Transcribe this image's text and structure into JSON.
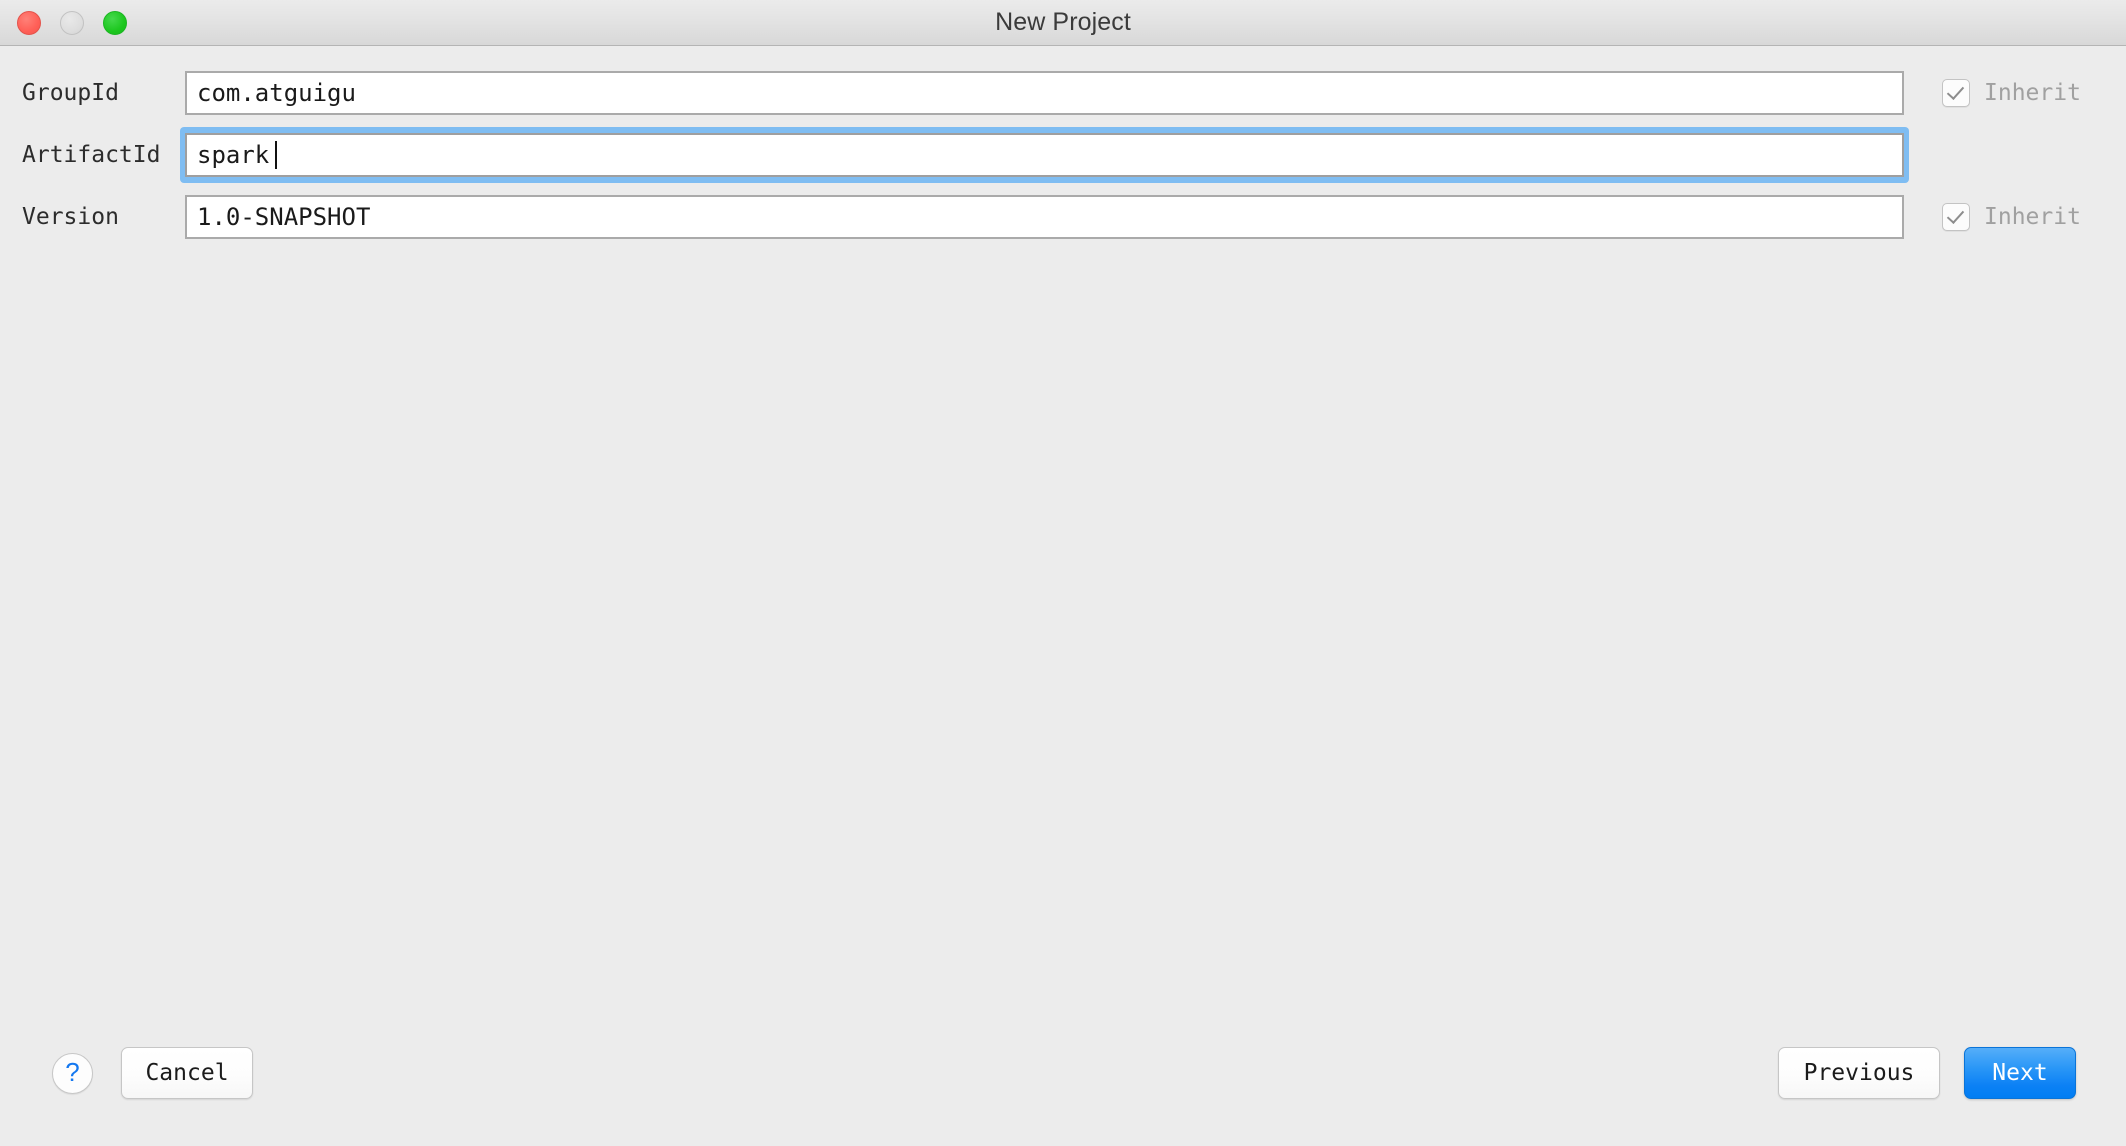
{
  "window": {
    "title": "New Project",
    "controls": {
      "close_label": "close",
      "minimize_label": "minimize",
      "zoom_label": "zoom"
    }
  },
  "form": {
    "rows": [
      {
        "label": "GroupId",
        "value": "com.atguigu",
        "placeholder": "",
        "focused": false,
        "inherit": {
          "visible": true,
          "checked": true,
          "label": "Inherit"
        }
      },
      {
        "label": "ArtifactId",
        "value": "spark",
        "placeholder": "",
        "focused": true,
        "inherit": {
          "visible": false,
          "checked": false,
          "label": "Inherit"
        }
      },
      {
        "label": "Version",
        "value": "1.0-SNAPSHOT",
        "placeholder": "",
        "focused": false,
        "inherit": {
          "visible": true,
          "checked": true,
          "label": "Inherit"
        }
      }
    ]
  },
  "footer": {
    "help_label": "?",
    "cancel_label": "Cancel",
    "previous_label": "Previous",
    "next_label": "Next"
  },
  "colors": {
    "window_bg": "#ececec",
    "titlebar_top": "#ebebeb",
    "titlebar_bottom": "#d8d8d8",
    "focus_ring": "#7fbdf2",
    "default_button": "#0c81f5",
    "help_glyph": "#1478f0",
    "traffic_close": "#ff5f57",
    "traffic_minimize": "#dedede",
    "traffic_zoom": "#1dc71f",
    "field_border": "#aaaaaa",
    "inherit_label": "#a0a0a0"
  }
}
